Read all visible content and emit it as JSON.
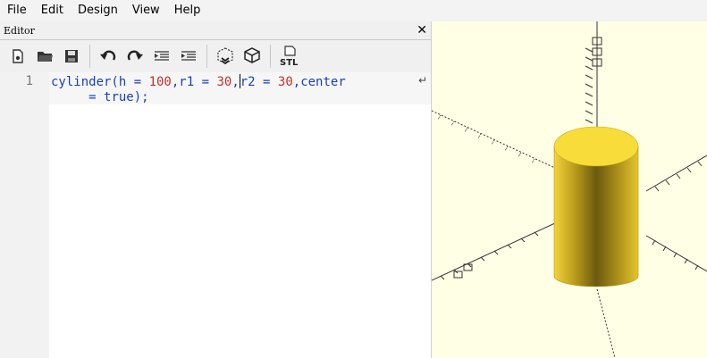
{
  "menu": [
    "File",
    "Edit",
    "Design",
    "View",
    "Help"
  ],
  "editor_panel": {
    "title": "Editor",
    "close_glyph": "✕"
  },
  "toolbar": {
    "buttons": [
      "new-file-icon",
      "open-folder-icon",
      "save-icon",
      "undo-icon",
      "redo-icon",
      "unindent-icon",
      "indent-icon",
      "preview-icon",
      "render-icon",
      "export-stl-icon"
    ],
    "stl_label": "STL"
  },
  "code": {
    "line_number": "1",
    "t1": "cylinder(h = ",
    "n1": "100",
    "t2": ",r1 = ",
    "n2": "30",
    "t3": ",",
    "t4": "r2 = ",
    "n3": "30",
    "t5": ",center",
    "t6": "     = ",
    "kw": "true",
    "t7": ");",
    "wrap_glyph": "↵"
  },
  "viewport": {
    "background": "#ffffe5",
    "cylinder_top": "#f7dc3a",
    "cylinder_body": "#d9b820"
  }
}
